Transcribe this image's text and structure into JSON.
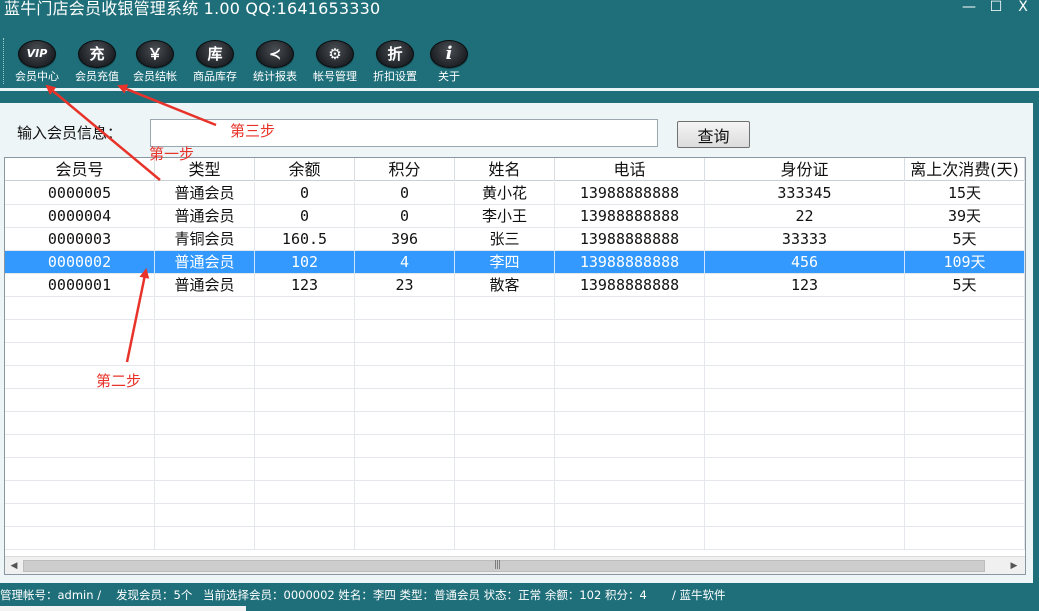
{
  "window": {
    "title": "蓝牛门店会员收银管理系统 1.00    QQ:1641653330",
    "minimize": "—",
    "maximize": "☐",
    "close": "X"
  },
  "toolbar": {
    "items": [
      {
        "icon": "vip-icon",
        "glyph": "VIP",
        "label": "会员中心"
      },
      {
        "icon": "recharge-icon",
        "glyph": "充",
        "label": "会员充值"
      },
      {
        "icon": "yen-icon",
        "glyph": "￥",
        "label": "会员结帐"
      },
      {
        "icon": "warehouse-icon",
        "glyph": "库",
        "label": "商品库存"
      },
      {
        "icon": "chart-icon",
        "glyph": "≺",
        "label": "统计报表"
      },
      {
        "icon": "user-gear-icon",
        "glyph": "⚙",
        "label": "帐号管理"
      },
      {
        "icon": "discount-icon",
        "glyph": "折",
        "label": "折扣设置"
      },
      {
        "icon": "info-icon",
        "glyph": "i",
        "label": "关于"
      }
    ]
  },
  "search": {
    "label": "输入会员信息：",
    "value": "",
    "button": "查询"
  },
  "table": {
    "columns": [
      "会员号",
      "类型",
      "余额",
      "积分",
      "姓名",
      "电话",
      "身份证",
      "离上次消费(天)"
    ],
    "rows": [
      [
        "0000005",
        "普通会员",
        "0",
        "0",
        "黄小花",
        "13988888888",
        "333345",
        "15天"
      ],
      [
        "0000004",
        "普通会员",
        "0",
        "0",
        "李小王",
        "13988888888",
        "22",
        "39天"
      ],
      [
        "0000003",
        "青铜会员",
        "160.5",
        "396",
        "张三",
        "13988888888",
        "33333",
        "5天"
      ],
      [
        "0000002",
        "普通会员",
        "102",
        "4",
        "李四",
        "13988888888",
        "456",
        "109天"
      ],
      [
        "0000001",
        "普通会员",
        "123",
        "23",
        "散客",
        "13988888888",
        "123",
        "5天"
      ]
    ],
    "selected_row": 3,
    "scroll_grip": "|||"
  },
  "annotations": {
    "step1": "第一步",
    "step2": "第二步",
    "step3": "第三步",
    "color": "#e8332a"
  },
  "statusbar": {
    "account": "管理帐号：admin /",
    "found": "发现会员：5个",
    "current": "当前选择会员：0000002 姓名：李四 类型：普通会员 状态：正常 余额：102 积分：4",
    "company": "/ 蓝牛软件"
  },
  "colors": {
    "frame": "#1f6f7a",
    "panel": "#eef5f7",
    "selection": "#3399ff"
  }
}
